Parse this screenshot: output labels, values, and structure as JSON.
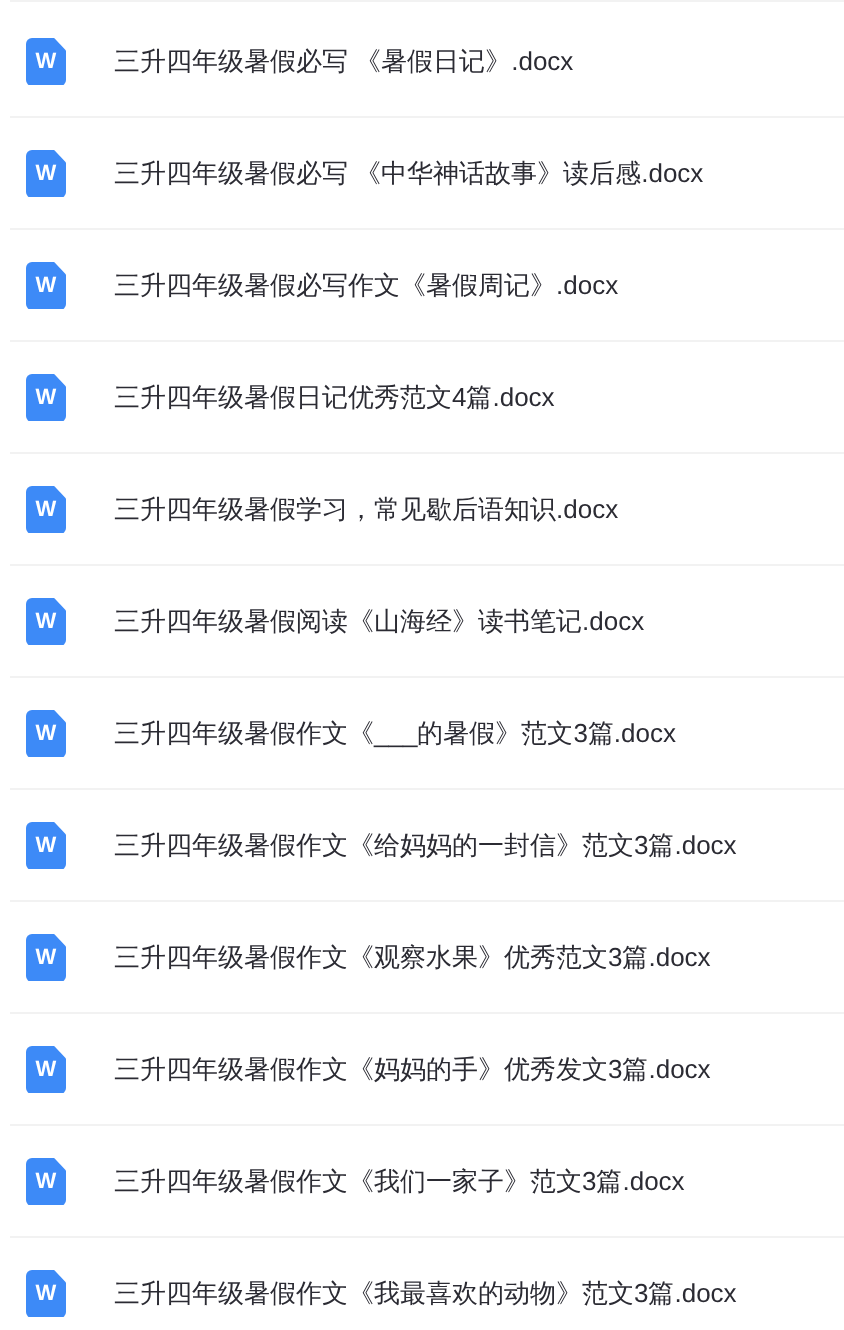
{
  "files": [
    {
      "icon": "W",
      "name": "三升四年级暑假必写 《暑假日记》.docx"
    },
    {
      "icon": "W",
      "name": "三升四年级暑假必写 《中华神话故事》读后感.docx"
    },
    {
      "icon": "W",
      "name": "三升四年级暑假必写作文《暑假周记》.docx"
    },
    {
      "icon": "W",
      "name": "三升四年级暑假日记优秀范文4篇.docx"
    },
    {
      "icon": "W",
      "name": "三升四年级暑假学习，常见歇后语知识.docx"
    },
    {
      "icon": "W",
      "name": "三升四年级暑假阅读《山海经》读书笔记.docx"
    },
    {
      "icon": "W",
      "name": "三升四年级暑假作文《___的暑假》范文3篇.docx"
    },
    {
      "icon": "W",
      "name": "三升四年级暑假作文《给妈妈的一封信》范文3篇.docx"
    },
    {
      "icon": "W",
      "name": "三升四年级暑假作文《观察水果》优秀范文3篇.docx"
    },
    {
      "icon": "W",
      "name": "三升四年级暑假作文《妈妈的手》优秀发文3篇.docx"
    },
    {
      "icon": "W",
      "name": "三升四年级暑假作文《我们一家子》范文3篇.docx"
    },
    {
      "icon": "W",
      "name": "三升四年级暑假作文《我最喜欢的动物》范文3篇.docx"
    }
  ]
}
